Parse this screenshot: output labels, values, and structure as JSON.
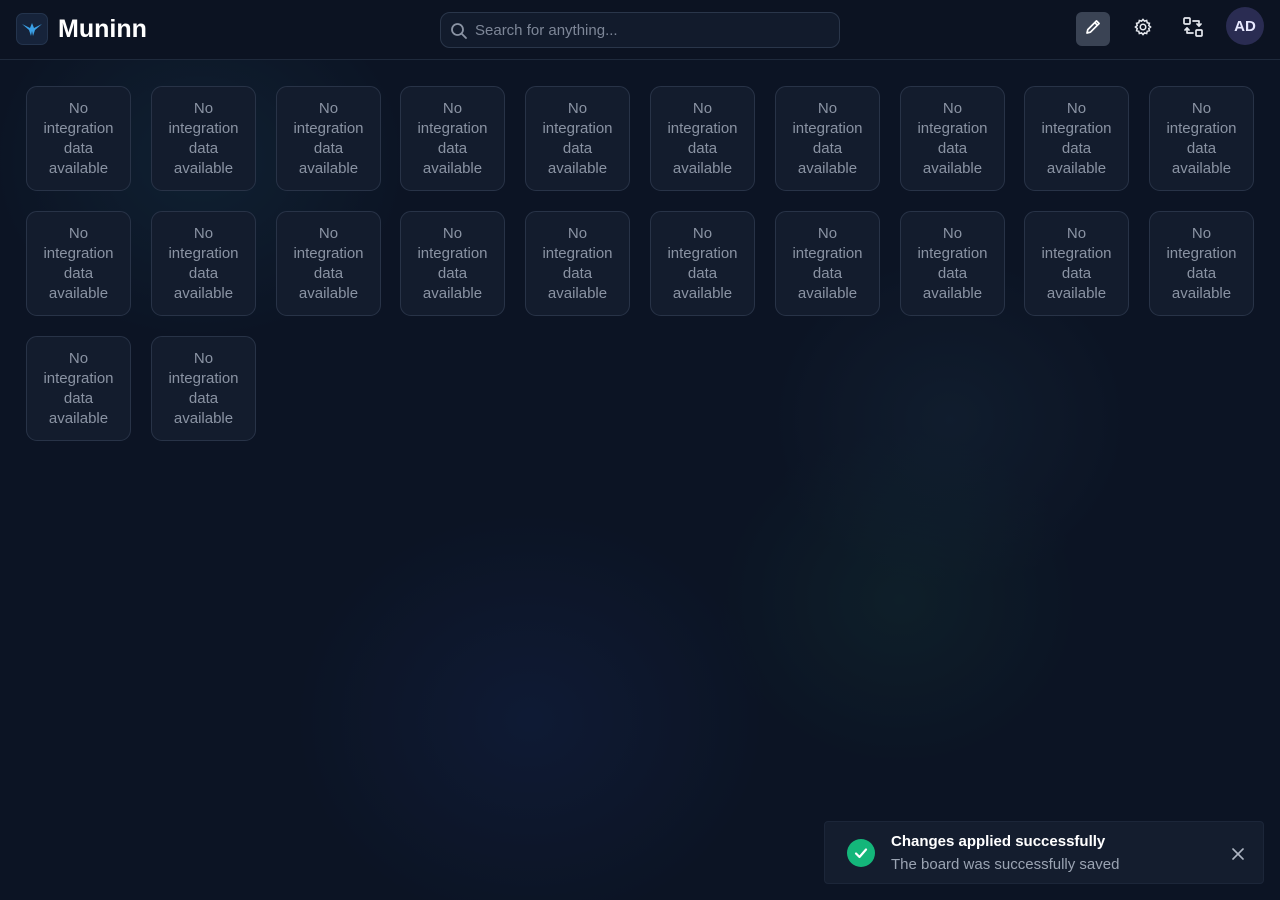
{
  "header": {
    "brand": "Muninn",
    "search_placeholder": "Search for anything...",
    "avatar_initials": "AD",
    "icons": {
      "logo": "raven-logo-icon",
      "search": "search-icon",
      "edit": "pencil-icon",
      "settings": "gear-icon",
      "swap": "swap-icon"
    }
  },
  "board": {
    "tiles": [
      "No integration data available",
      "No integration data available",
      "No integration data available",
      "No integration data available",
      "No integration data available",
      "No integration data available",
      "No integration data available",
      "No integration data available",
      "No integration data available",
      "No integration data available",
      "No integration data available",
      "No integration data available",
      "No integration data available",
      "No integration data available",
      "No integration data available",
      "No integration data available",
      "No integration data available",
      "No integration data available",
      "No integration data available",
      "No integration data available",
      "No integration data available",
      "No integration data available"
    ]
  },
  "toast": {
    "title": "Changes applied successfully",
    "message": "The board was successfully saved",
    "icons": {
      "status": "check-circle-icon",
      "close": "close-icon"
    }
  },
  "colors": {
    "background": "#0c1424",
    "tile": "#131c2d",
    "success": "#14b67a",
    "avatar": "#2a2c52"
  }
}
